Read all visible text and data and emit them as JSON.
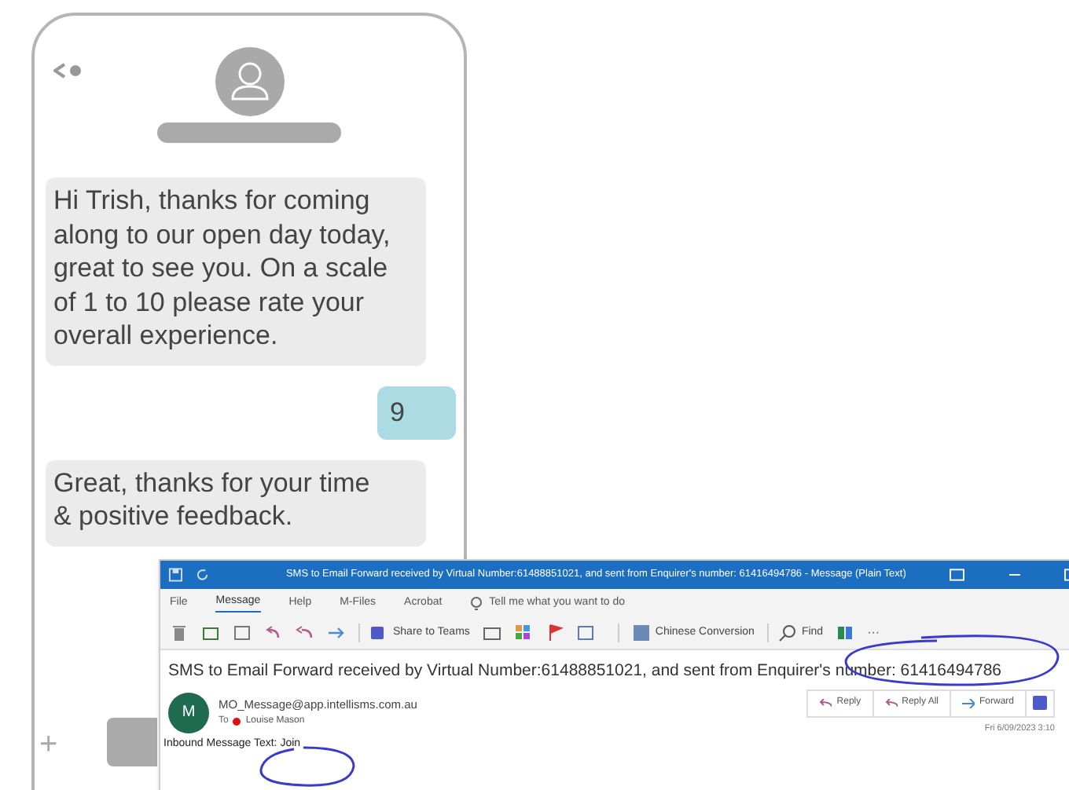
{
  "phone": {
    "messages": [
      {
        "kind": "incoming",
        "text": "Hi Trish, thanks for coming along to our open day today, great to see you. On a scale of 1 to 10 please rate your overall experience."
      },
      {
        "kind": "outgoing",
        "text": "9"
      },
      {
        "kind": "incoming",
        "text": "Great, thanks for your time & positive feedback."
      }
    ],
    "compose_plus": "+"
  },
  "email_window": {
    "title": "SMS to Email Forward received by Virtual Number:61488851021, and sent from Enquirer's number: 61416494786  -  Message (Plain Text)",
    "ribbon_tabs": [
      {
        "label": "File",
        "selected": false
      },
      {
        "label": "Message",
        "selected": true
      },
      {
        "label": "Help",
        "selected": false
      },
      {
        "label": "M-Files",
        "selected": false
      },
      {
        "label": "Acrobat",
        "selected": false
      }
    ],
    "tell_me": "Tell me what you want to do",
    "toolbar": {
      "share": "Share to Teams",
      "conversion": "Chinese Conversion",
      "find": "Find",
      "more": "···"
    },
    "subject": "SMS to Email Forward received by Virtual Number:61488851021, and sent from Enquirer's number: 61416494786",
    "sender": {
      "initial": "M",
      "address": "MO_Message@app.intellisms.com.au",
      "to_label": "To",
      "recipient": "Louise Mason"
    },
    "actions": [
      "Reply",
      "Reply All",
      "Forward"
    ],
    "date": "Fri 6/09/2023 3:10",
    "body": "Inbound Message Text: Join"
  }
}
